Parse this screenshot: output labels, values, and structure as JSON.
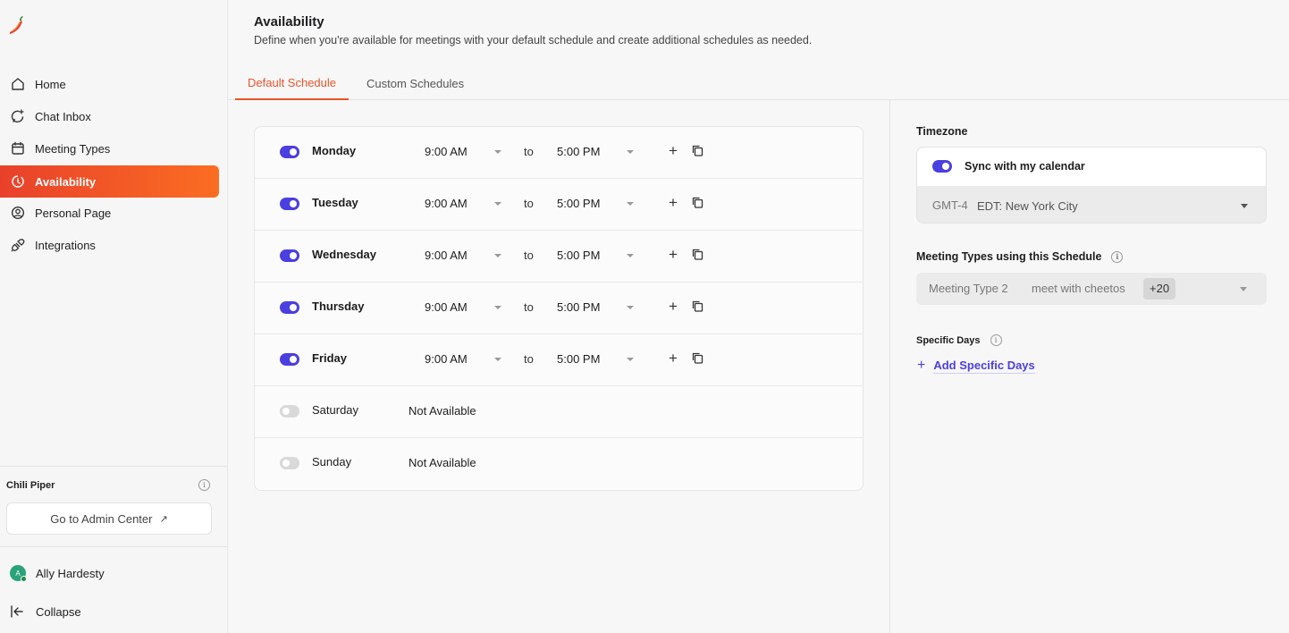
{
  "brand": {
    "name": "Chili Piper",
    "accent": "#e8532a",
    "primary": "#4a3fe0"
  },
  "sidebar": {
    "items": [
      {
        "label": "Home",
        "icon": "home-icon"
      },
      {
        "label": "Chat Inbox",
        "icon": "chat-icon"
      },
      {
        "label": "Meeting Types",
        "icon": "calendar-icon"
      },
      {
        "label": "Availability",
        "icon": "clock-icon",
        "active": true
      },
      {
        "label": "Personal Page",
        "icon": "user-circle-icon"
      },
      {
        "label": "Integrations",
        "icon": "plug-icon"
      }
    ],
    "org_name": "Chili Piper",
    "admin_button": "Go to Admin Center",
    "user_name": "Ally Hardesty",
    "user_initial": "A",
    "collapse_label": "Collapse"
  },
  "header": {
    "title": "Availability",
    "subtitle": "Define when you're available for meetings with your default schedule and create additional schedules as needed."
  },
  "tabs": [
    {
      "label": "Default Schedule",
      "active": true
    },
    {
      "label": "Custom Schedules",
      "active": false
    }
  ],
  "schedule": {
    "to_label": "to",
    "days": [
      {
        "day": "Monday",
        "enabled": true,
        "start": "9:00 AM",
        "end": "5:00 PM"
      },
      {
        "day": "Tuesday",
        "enabled": true,
        "start": "9:00 AM",
        "end": "5:00 PM"
      },
      {
        "day": "Wednesday",
        "enabled": true,
        "start": "9:00 AM",
        "end": "5:00 PM"
      },
      {
        "day": "Thursday",
        "enabled": true,
        "start": "9:00 AM",
        "end": "5:00 PM"
      },
      {
        "day": "Friday",
        "enabled": true,
        "start": "9:00 AM",
        "end": "5:00 PM"
      },
      {
        "day": "Saturday",
        "enabled": false,
        "status": "Not Available"
      },
      {
        "day": "Sunday",
        "enabled": false,
        "status": "Not Available"
      }
    ]
  },
  "timezone": {
    "label": "Timezone",
    "sync_label": "Sync with my calendar",
    "sync_enabled": true,
    "code": "GMT-4",
    "name": "EDT: New York City"
  },
  "meeting_types": {
    "label": "Meeting Types using this Schedule",
    "items": [
      "Meeting Type 2",
      "meet with cheetos"
    ],
    "more": "+20"
  },
  "specific_days": {
    "label": "Specific Days",
    "add_label": "Add Specific Days"
  }
}
